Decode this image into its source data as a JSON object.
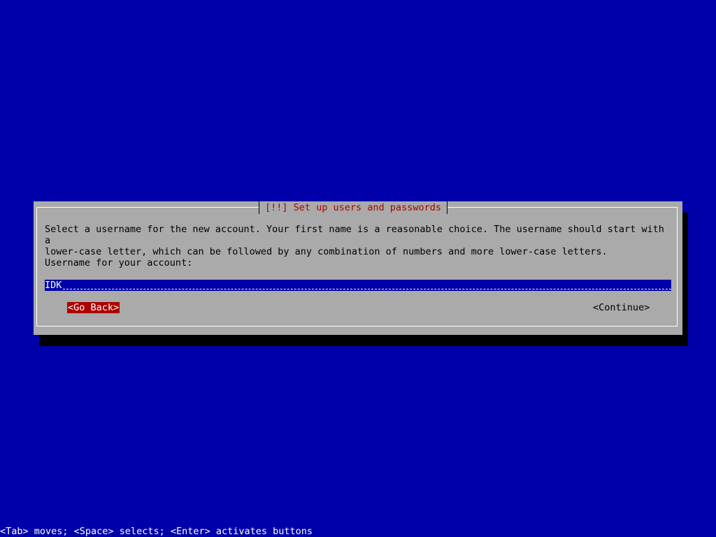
{
  "dialog": {
    "title": "[!!] Set up users and passwords",
    "description": "Select a username for the new account. Your first name is a reasonable choice. The username should start with a\nlower-case letter, which can be followed by any combination of numbers and more lower-case letters.",
    "prompt": "Username for your account:",
    "username_value": "IDK",
    "go_back_label": "<Go Back>",
    "continue_label": "<Continue>"
  },
  "footer": {
    "help": "<Tab> moves; <Space> selects; <Enter> activates buttons"
  },
  "colors": {
    "background": "#0000aa",
    "dialog": "#aaaaaa",
    "title": "#aa0000",
    "selected_button": "#aa0000",
    "input_bg": "#0000aa",
    "shadow": "#000000"
  }
}
